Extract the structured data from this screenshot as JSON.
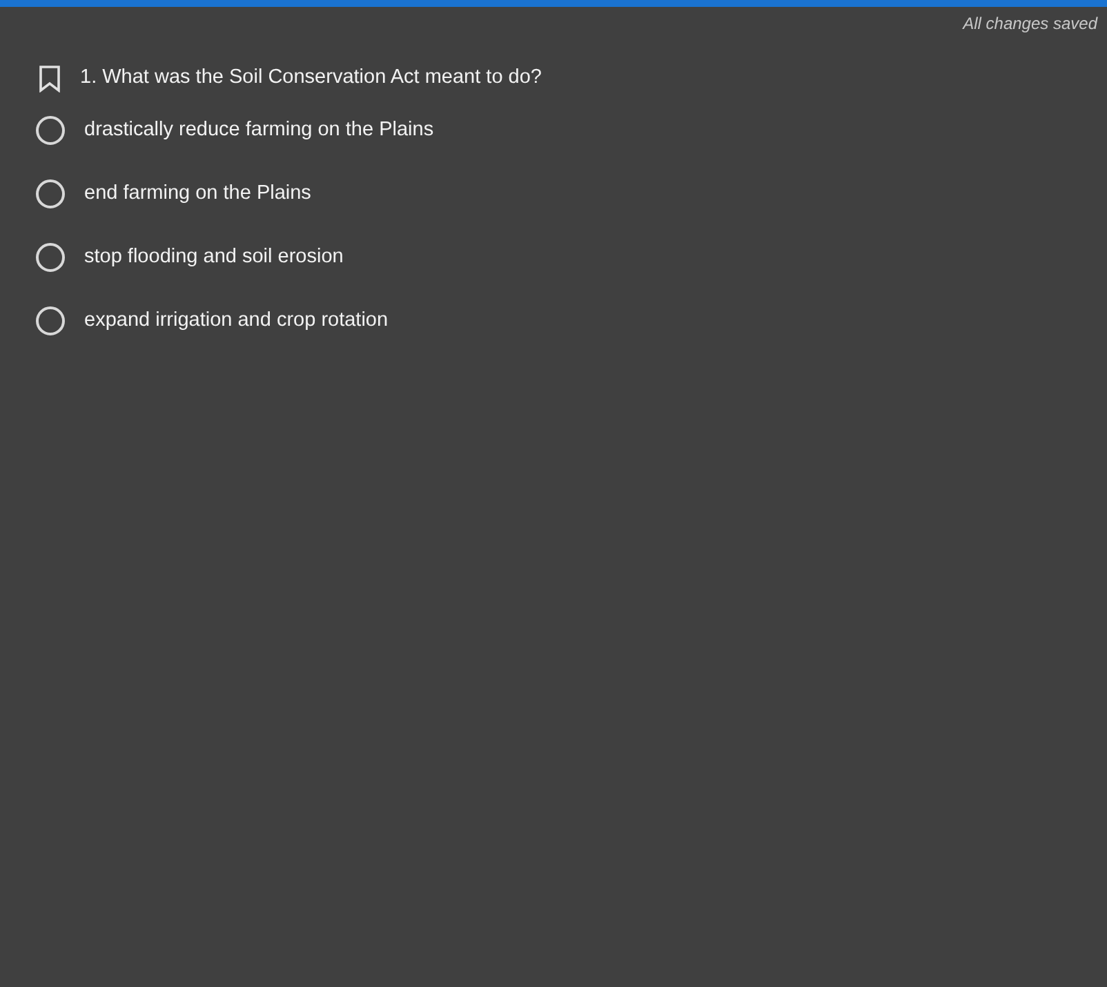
{
  "status": "All changes saved",
  "question": {
    "text": "1. What was the Soil Conservation Act meant to do?",
    "bookmarked": false
  },
  "choices": [
    {
      "label": "drastically reduce farming on the Plains",
      "selected": false
    },
    {
      "label": "end farming on the Plains",
      "selected": false
    },
    {
      "label": "stop flooding and soil erosion",
      "selected": false
    },
    {
      "label": "expand irrigation and crop rotation",
      "selected": false
    }
  ]
}
